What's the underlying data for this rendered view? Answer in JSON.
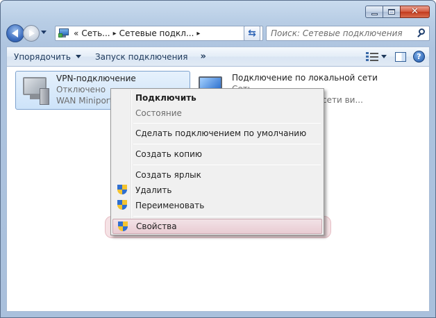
{
  "window": {
    "caption": {
      "minimize": "minimize",
      "maximize": "maximize",
      "close": "close"
    }
  },
  "nav": {
    "address": {
      "overflow": "«",
      "crumbs": [
        "Сеть...",
        "Сетевые подкл..."
      ],
      "separator": "▸"
    },
    "search": {
      "placeholder": "Поиск: Сетевые подключения"
    }
  },
  "command_bar": {
    "organize_label": "Упорядочить",
    "start_connection_label": "Запуск подключения",
    "more_label": "»"
  },
  "connections": [
    {
      "name": "VPN-подключение",
      "status": "Отключено",
      "device": "WAN Miniport",
      "selected": true
    },
    {
      "name": "Подключение по локальной сети",
      "status": "Сеть",
      "device": "сети ви..."
    }
  ],
  "context_menu": {
    "items": [
      {
        "label": "Подключить",
        "bold": true
      },
      {
        "label": "Состояние",
        "disabled": true
      },
      {
        "label": "Сделать подключением по умолчанию"
      },
      {
        "label": "Создать копию"
      },
      {
        "label": "Создать ярлык"
      },
      {
        "label": "Удалить",
        "shield": true
      },
      {
        "label": "Переименовать",
        "shield": true
      },
      {
        "label": "Свойства",
        "shield": true,
        "highlighted": true
      }
    ]
  },
  "colors": {
    "highlight": "#e9ccd3",
    "accent": "#2f6fd0"
  }
}
